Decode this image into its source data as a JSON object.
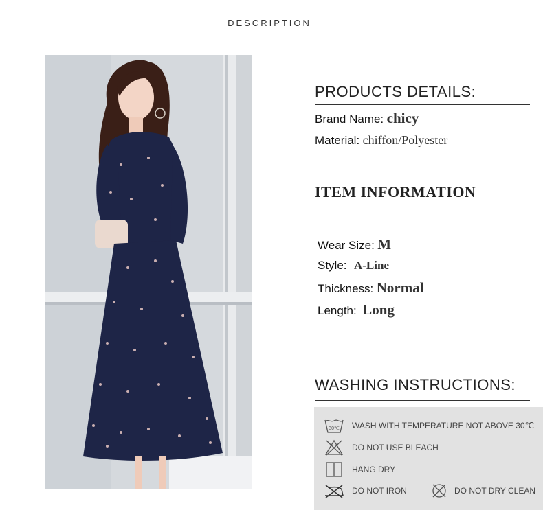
{
  "header": {
    "title": "DESCRIPTION"
  },
  "products_details": {
    "title": "PRODUCTS DETAILS:",
    "brand_label": "Brand Name:",
    "brand_value": "chicy",
    "material_label": "Material:",
    "material_value": "chiffon/Polyester"
  },
  "item_information": {
    "title": "ITEM INFORMATION",
    "wear_size_label": "Wear Size:",
    "wear_size_value": "M",
    "style_label": "Style:",
    "style_value": "A-Line",
    "thickness_label": "Thickness:",
    "thickness_value": "Normal",
    "length_label": "Length:",
    "length_value": "Long"
  },
  "washing": {
    "title": "WASHING INSTRUCTIONS:",
    "items": [
      {
        "icon": "wash-30-icon",
        "text": "WASH WITH TEMPERATURE NOT ABOVE 30℃",
        "icon_text": "30℃"
      },
      {
        "icon": "no-bleach-icon",
        "text": "DO NOT USE BLEACH"
      },
      {
        "icon": "hang-dry-icon",
        "text": "HANG DRY"
      },
      {
        "icon": "no-iron-icon",
        "text": "DO NOT IRON"
      },
      {
        "icon": "no-dry-clean-icon",
        "text": "DO NOT DRY CLEAN"
      }
    ]
  },
  "colors": {
    "dress": "#1e2547",
    "panel": "#e2e2e2",
    "rule": "#333333"
  }
}
